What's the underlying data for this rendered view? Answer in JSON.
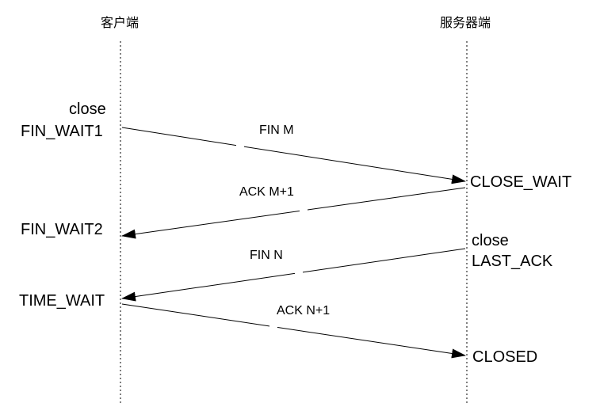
{
  "columns": {
    "client": "客户端",
    "server": "服务器端"
  },
  "client_states": {
    "close": "close",
    "fin_wait1": "FIN_WAIT1",
    "fin_wait2": "FIN_WAIT2",
    "time_wait": "TIME_WAIT"
  },
  "server_states": {
    "close_wait": "CLOSE_WAIT",
    "close": "close",
    "last_ack": "LAST_ACK",
    "closed": "CLOSED"
  },
  "messages": [
    {
      "label": "FIN M",
      "direction": "client-to-server"
    },
    {
      "label": "ACK M+1",
      "direction": "server-to-client"
    },
    {
      "label": "FIN N",
      "direction": "server-to-client"
    },
    {
      "label": "ACK N+1",
      "direction": "client-to-server"
    }
  ]
}
